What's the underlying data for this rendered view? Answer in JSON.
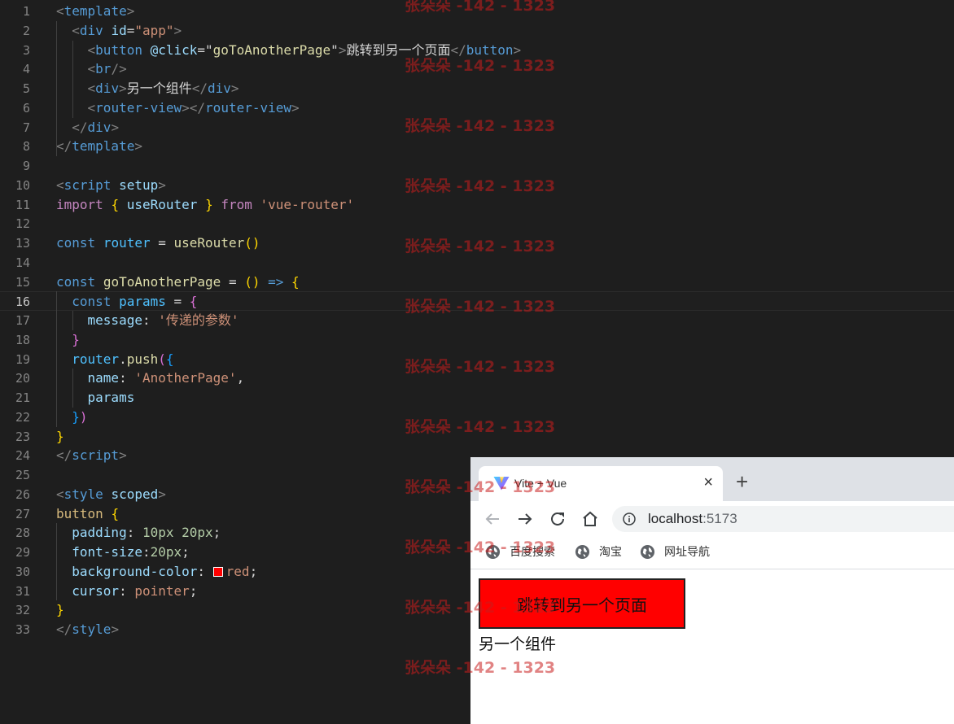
{
  "editor": {
    "lines": [
      {
        "n": "1",
        "tokens": [
          [
            "t-tag",
            "<"
          ],
          [
            "t-name",
            "template"
          ],
          [
            "t-tag",
            ">"
          ]
        ]
      },
      {
        "n": "2",
        "tokens": [
          [
            "",
            "  "
          ],
          [
            "t-tag",
            "<"
          ],
          [
            "t-name",
            "div"
          ],
          [
            "",
            " "
          ],
          [
            "t-attr",
            "id"
          ],
          [
            "",
            "="
          ],
          [
            "t-str",
            "\"app\""
          ],
          [
            "t-tag",
            ">"
          ]
        ]
      },
      {
        "n": "3",
        "tokens": [
          [
            "",
            "    "
          ],
          [
            "t-tag",
            "<"
          ],
          [
            "t-name",
            "button"
          ],
          [
            "",
            " "
          ],
          [
            "t-attr",
            "@click"
          ],
          [
            "",
            "=\""
          ],
          [
            "t-fn",
            "goToAnotherPage"
          ],
          [
            "",
            "\""
          ],
          [
            "t-tag",
            ">"
          ],
          [
            "",
            "跳转到另一个页面"
          ],
          [
            "t-tag",
            "</"
          ],
          [
            "t-name",
            "button"
          ],
          [
            "t-tag",
            ">"
          ]
        ]
      },
      {
        "n": "4",
        "tokens": [
          [
            "",
            "    "
          ],
          [
            "t-tag",
            "<"
          ],
          [
            "t-name",
            "br"
          ],
          [
            "t-tag",
            "/>"
          ]
        ]
      },
      {
        "n": "5",
        "tokens": [
          [
            "",
            "    "
          ],
          [
            "t-tag",
            "<"
          ],
          [
            "t-name",
            "div"
          ],
          [
            "t-tag",
            ">"
          ],
          [
            "",
            "另一个组件"
          ],
          [
            "t-tag",
            "</"
          ],
          [
            "t-name",
            "div"
          ],
          [
            "t-tag",
            ">"
          ]
        ]
      },
      {
        "n": "6",
        "tokens": [
          [
            "",
            "    "
          ],
          [
            "t-tag",
            "<"
          ],
          [
            "t-name",
            "router-view"
          ],
          [
            "t-tag",
            "></"
          ],
          [
            "t-name",
            "router-view"
          ],
          [
            "t-tag",
            ">"
          ]
        ]
      },
      {
        "n": "7",
        "tokens": [
          [
            "",
            "  "
          ],
          [
            "t-tag",
            "</"
          ],
          [
            "t-name",
            "div"
          ],
          [
            "t-tag",
            ">"
          ]
        ]
      },
      {
        "n": "8",
        "tokens": [
          [
            "t-tag",
            "</"
          ],
          [
            "t-name",
            "template"
          ],
          [
            "t-tag",
            ">"
          ]
        ]
      },
      {
        "n": "9",
        "tokens": []
      },
      {
        "n": "10",
        "tokens": [
          [
            "t-tag",
            "<"
          ],
          [
            "t-name",
            "script"
          ],
          [
            "",
            " "
          ],
          [
            "t-attr",
            "setup"
          ],
          [
            "t-tag",
            ">"
          ]
        ]
      },
      {
        "n": "11",
        "tokens": [
          [
            "t-kw",
            "import"
          ],
          [
            "",
            " "
          ],
          [
            "t-b1",
            "{"
          ],
          [
            "",
            " "
          ],
          [
            "t-prop",
            "useRouter"
          ],
          [
            "",
            " "
          ],
          [
            "t-b1",
            "}"
          ],
          [
            "",
            " "
          ],
          [
            "t-kw",
            "from"
          ],
          [
            "",
            " "
          ],
          [
            "t-str",
            "'vue-router'"
          ]
        ]
      },
      {
        "n": "12",
        "tokens": []
      },
      {
        "n": "13",
        "tokens": [
          [
            "t-decl",
            "const"
          ],
          [
            "",
            " "
          ],
          [
            "t-var",
            "router"
          ],
          [
            "",
            " = "
          ],
          [
            "t-fn",
            "useRouter"
          ],
          [
            "t-b1",
            "()"
          ]
        ]
      },
      {
        "n": "14",
        "tokens": []
      },
      {
        "n": "15",
        "tokens": [
          [
            "t-decl",
            "const"
          ],
          [
            "",
            " "
          ],
          [
            "t-fn",
            "goToAnotherPage"
          ],
          [
            "",
            " = "
          ],
          [
            "t-b1",
            "()"
          ],
          [
            "",
            " "
          ],
          [
            "t-decl",
            "=>"
          ],
          [
            "",
            " "
          ],
          [
            "t-b1",
            "{"
          ]
        ]
      },
      {
        "n": "16",
        "tokens": [
          [
            "",
            "  "
          ],
          [
            "t-decl",
            "const"
          ],
          [
            "",
            " "
          ],
          [
            "t-var",
            "params"
          ],
          [
            "",
            " = "
          ],
          [
            "t-b2",
            "{"
          ]
        ]
      },
      {
        "n": "17",
        "tokens": [
          [
            "",
            "    "
          ],
          [
            "t-prop",
            "message"
          ],
          [
            "",
            ": "
          ],
          [
            "t-str",
            "'传递的参数'"
          ]
        ]
      },
      {
        "n": "18",
        "tokens": [
          [
            "",
            "  "
          ],
          [
            "t-b2",
            "}"
          ]
        ]
      },
      {
        "n": "19",
        "tokens": [
          [
            "",
            "  "
          ],
          [
            "t-var",
            "router"
          ],
          [
            "",
            "."
          ],
          [
            "t-fn",
            "push"
          ],
          [
            "t-b2",
            "("
          ],
          [
            "t-b3",
            "{"
          ]
        ]
      },
      {
        "n": "20",
        "tokens": [
          [
            "",
            "    "
          ],
          [
            "t-prop",
            "name"
          ],
          [
            "",
            ": "
          ],
          [
            "t-str",
            "'AnotherPage'"
          ],
          [
            "",
            ","
          ]
        ]
      },
      {
        "n": "21",
        "tokens": [
          [
            "",
            "    "
          ],
          [
            "t-prop",
            "params"
          ]
        ]
      },
      {
        "n": "22",
        "tokens": [
          [
            "",
            "  "
          ],
          [
            "t-b3",
            "}"
          ],
          [
            "t-b2",
            ")"
          ]
        ]
      },
      {
        "n": "23",
        "tokens": [
          [
            "t-b1",
            "}"
          ]
        ]
      },
      {
        "n": "24",
        "tokens": [
          [
            "t-tag",
            "</"
          ],
          [
            "t-name",
            "script"
          ],
          [
            "t-tag",
            ">"
          ]
        ]
      },
      {
        "n": "25",
        "tokens": []
      },
      {
        "n": "26",
        "tokens": [
          [
            "t-tag",
            "<"
          ],
          [
            "t-name",
            "style"
          ],
          [
            "",
            " "
          ],
          [
            "t-attr",
            "scoped"
          ],
          [
            "t-tag",
            ">"
          ]
        ]
      },
      {
        "n": "27",
        "tokens": [
          [
            "t-css",
            "button"
          ],
          [
            "",
            " "
          ],
          [
            "t-b1",
            "{"
          ]
        ]
      },
      {
        "n": "28",
        "tokens": [
          [
            "",
            "  "
          ],
          [
            "t-prop",
            "padding"
          ],
          [
            "",
            ": "
          ],
          [
            "t-num",
            "10px"
          ],
          [
            "",
            " "
          ],
          [
            "t-num",
            "20px"
          ],
          [
            "",
            ";"
          ]
        ]
      },
      {
        "n": "29",
        "tokens": [
          [
            "",
            "  "
          ],
          [
            "t-prop",
            "font-size"
          ],
          [
            "",
            ":"
          ],
          [
            "t-num",
            "20px"
          ],
          [
            "",
            ";"
          ]
        ]
      },
      {
        "n": "30",
        "tokens": [
          [
            "",
            "  "
          ],
          [
            "t-prop",
            "background-color"
          ],
          [
            "",
            ": "
          ],
          [
            "swatch",
            ""
          ],
          [
            "t-val",
            "red"
          ],
          [
            "",
            ";"
          ]
        ]
      },
      {
        "n": "31",
        "tokens": [
          [
            "",
            "  "
          ],
          [
            "t-prop",
            "cursor"
          ],
          [
            "",
            ": "
          ],
          [
            "t-val",
            "pointer"
          ],
          [
            "",
            ";"
          ]
        ]
      },
      {
        "n": "32",
        "tokens": [
          [
            "t-b1",
            "}"
          ]
        ]
      },
      {
        "n": "33",
        "tokens": [
          [
            "t-tag",
            "</"
          ],
          [
            "t-name",
            "style"
          ],
          [
            "t-tag",
            ">"
          ]
        ]
      }
    ],
    "active_line": "16",
    "swatch_color": "#ff0000"
  },
  "browser": {
    "tab_title": "Vite + Vue",
    "tab_favicon": "vite-logo-icon",
    "tab_close": "×",
    "new_tab": "+",
    "url_host": "localhost",
    "url_port": ":5173",
    "bookmarks": [
      "百度搜索",
      "淘宝",
      "网址导航"
    ],
    "page": {
      "button_label": "跳转到另一个页面",
      "button_color": "#ff0000",
      "text": "另一个组件"
    }
  },
  "watermark": "张朵朵 -142 - 1323"
}
